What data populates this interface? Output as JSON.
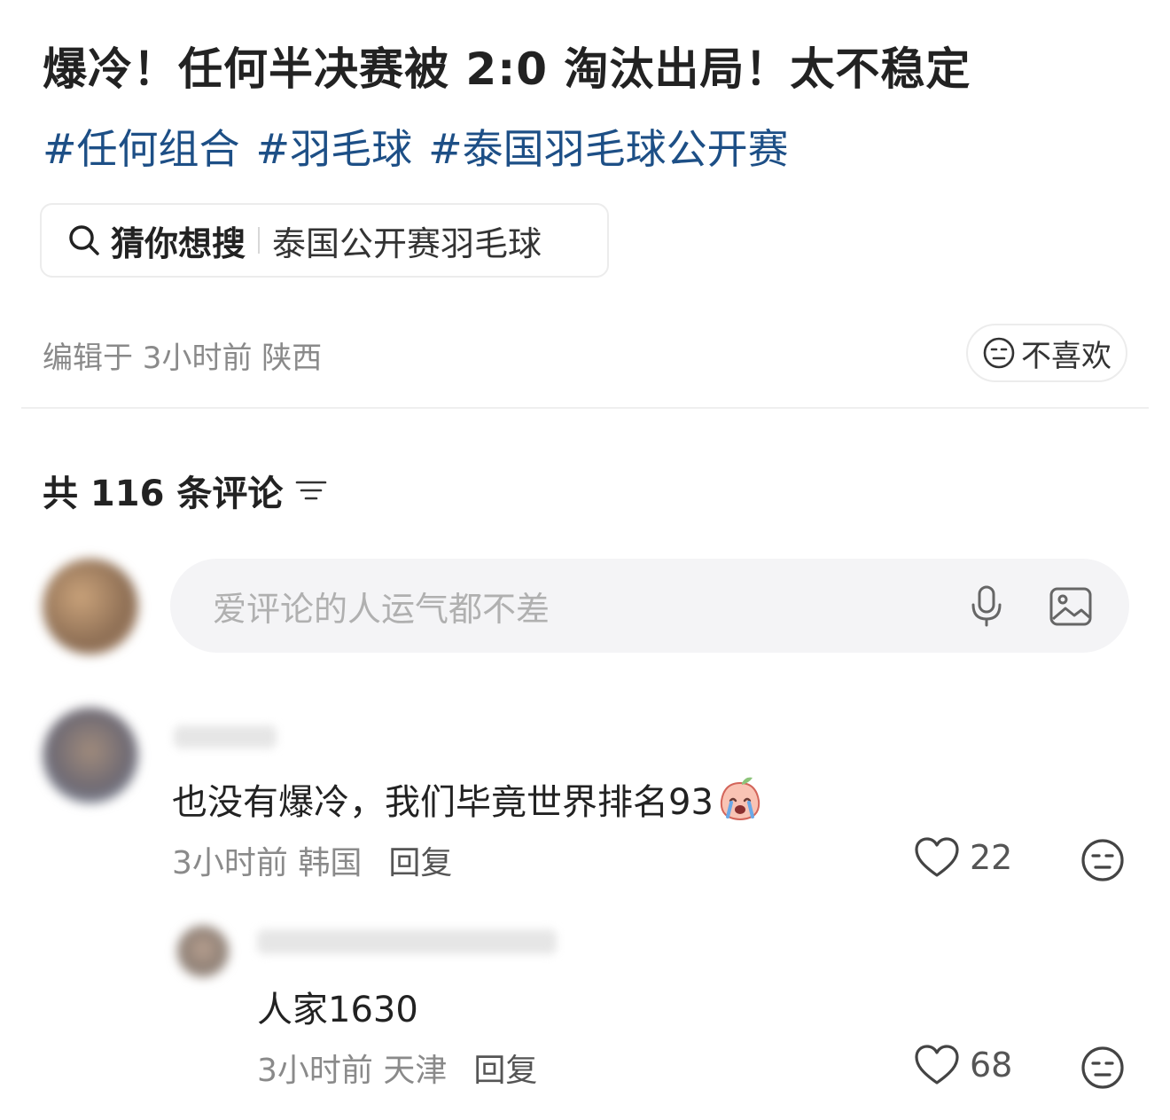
{
  "post": {
    "title": "爆冷！任何半决赛被 2:0 淘汰出局！太不稳定",
    "tags": [
      "#任何组合",
      "#羽毛球",
      "#泰国羽毛球公开赛"
    ],
    "guess_label": "猜你想搜",
    "guess_keyword": "泰国公开赛羽毛球",
    "meta": "编辑于 3小时前 陕西",
    "dislike_label": "不喜欢"
  },
  "comments_header": {
    "count_text": "共 116 条评论"
  },
  "comment_input": {
    "placeholder": "爱评论的人运气都不差"
  },
  "comments": [
    {
      "text": "也没有爆冷，我们毕竟世界排名93",
      "time_location": "3小时前 韩国",
      "reply_label": "回复",
      "likes": "22"
    },
    {
      "text": "人家1630",
      "time_location": "3小时前 天津",
      "reply_label": "回复",
      "likes": "68"
    }
  ],
  "colors": {
    "tag_blue": "#1d4f86",
    "muted_text": "#8a8a8a",
    "input_bg": "#f4f4f6"
  }
}
